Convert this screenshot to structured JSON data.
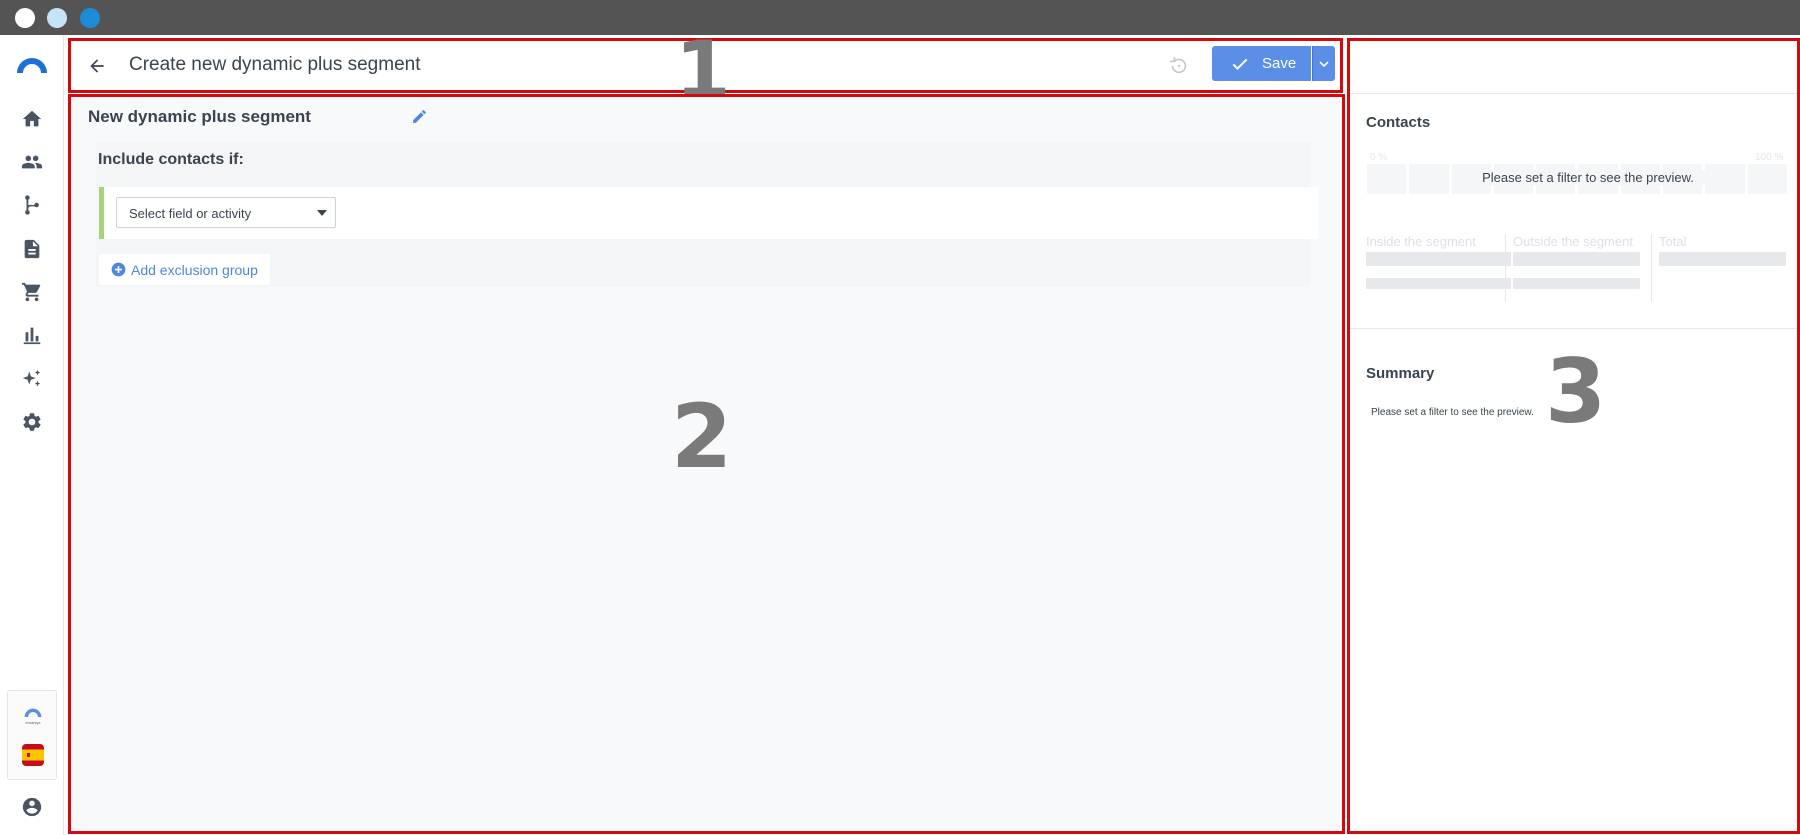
{
  "header": {
    "title": "Create new dynamic plus segment",
    "save_label": "Save",
    "annotation": "1"
  },
  "nav": {
    "items": [
      "home-icon",
      "contacts-icon",
      "flows-icon",
      "documents-icon",
      "cart-icon",
      "reports-icon",
      "ai-sparkle-icon",
      "settings-icon"
    ],
    "mini_logo_text": "emarsys"
  },
  "editor": {
    "segment_name": "New dynamic plus segment",
    "include_label": "Include contacts if:",
    "field_select_placeholder": "Select field or activity",
    "add_exclusion_label": "Add exclusion group",
    "annotation": "2"
  },
  "preview": {
    "contacts_title": "Contacts",
    "range_min": "0 %",
    "range_max": "100 %",
    "preview_message": "Please set a filter to see the preview.",
    "inside_label": "Inside the segment",
    "outside_label": "Outside the segment",
    "total_label": "Total",
    "summary_title": "Summary",
    "summary_message": "Please set a filter to see the preview.",
    "annotation": "3"
  },
  "colors": {
    "accent": "#5b8ee6",
    "highlight_border": "#d4090d",
    "include_rule_bar": "#a7d27c"
  }
}
